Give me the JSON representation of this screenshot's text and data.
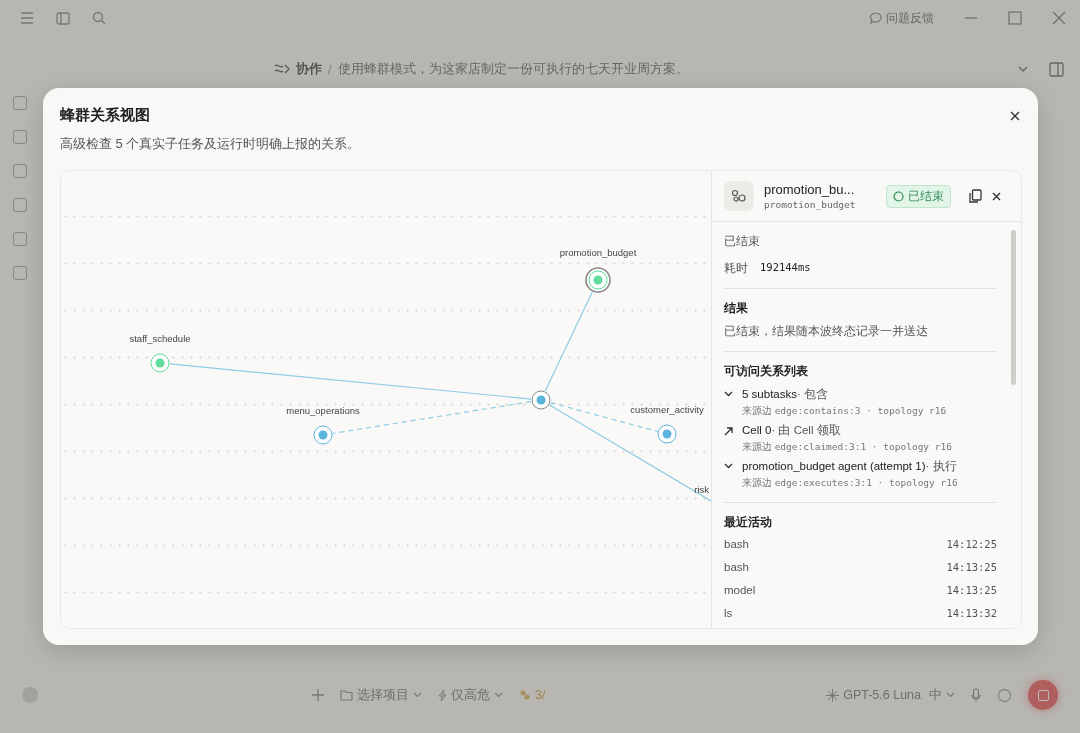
{
  "topbar": {
    "feedback": "问题反馈"
  },
  "breadcrumb": {
    "section": "协作",
    "separator": "/",
    "task": "使用蜂群模式，为这家店制定一份可执行的七天开业周方案。"
  },
  "composer": {
    "project": "选择项目",
    "filter": "仅高危",
    "count": "3/",
    "model": "GPT-5.6 Luna",
    "effort": "中"
  },
  "dialog": {
    "title": "蜂群关系视图",
    "subtitle": "高级检查 5 个真实子任务及运行时明确上报的关系。",
    "graph": {
      "hub": {
        "color": "#5ab4dc"
      },
      "nodes": [
        {
          "label": "promotion_budget",
          "color": "#5fdc9a",
          "selected": true,
          "dashed": false
        },
        {
          "label": "staff_schedule",
          "color": "#5fdc9a",
          "selected": false,
          "dashed": false
        },
        {
          "label": "menu_operations",
          "color": "#5ab4dc",
          "selected": false,
          "dashed": true
        },
        {
          "label": "customer_activity",
          "color": "#5ab4dc",
          "selected": false,
          "dashed": true
        },
        {
          "label": "risk",
          "dashed": false
        }
      ]
    },
    "detail": {
      "title": "promotion_bu...",
      "id": "promotion_budget",
      "status": "已结束",
      "state": "已结束",
      "duration_label": "耗时",
      "duration": "192144ms",
      "result_heading": "结果",
      "result": "已结束，结果随本波终态记录一并送达",
      "relations_heading": "可访问关系列表",
      "relations": [
        {
          "kind": "expand",
          "title": "5 subtasks",
          "type": "· 包含",
          "source_label": "来源边",
          "source": "edge:contains:3 · topology r16"
        },
        {
          "kind": "link",
          "title": "Cell 0",
          "type": "· 由 Cell 领取",
          "source_label": "来源边",
          "source": "edge:claimed:3:1 · topology r16"
        },
        {
          "kind": "expand",
          "title": "promotion_budget agent (attempt 1)",
          "type": "· 执行",
          "source_label": "来源边",
          "source": "edge:executes:3:1 · topology r16"
        }
      ],
      "activity_heading": "最近活动",
      "activity": [
        {
          "name": "bash",
          "time": "14:12:25"
        },
        {
          "name": "bash",
          "time": "14:13:25"
        },
        {
          "name": "model",
          "time": "14:13:25"
        },
        {
          "name": "ls",
          "time": "14:13:32"
        }
      ]
    }
  }
}
